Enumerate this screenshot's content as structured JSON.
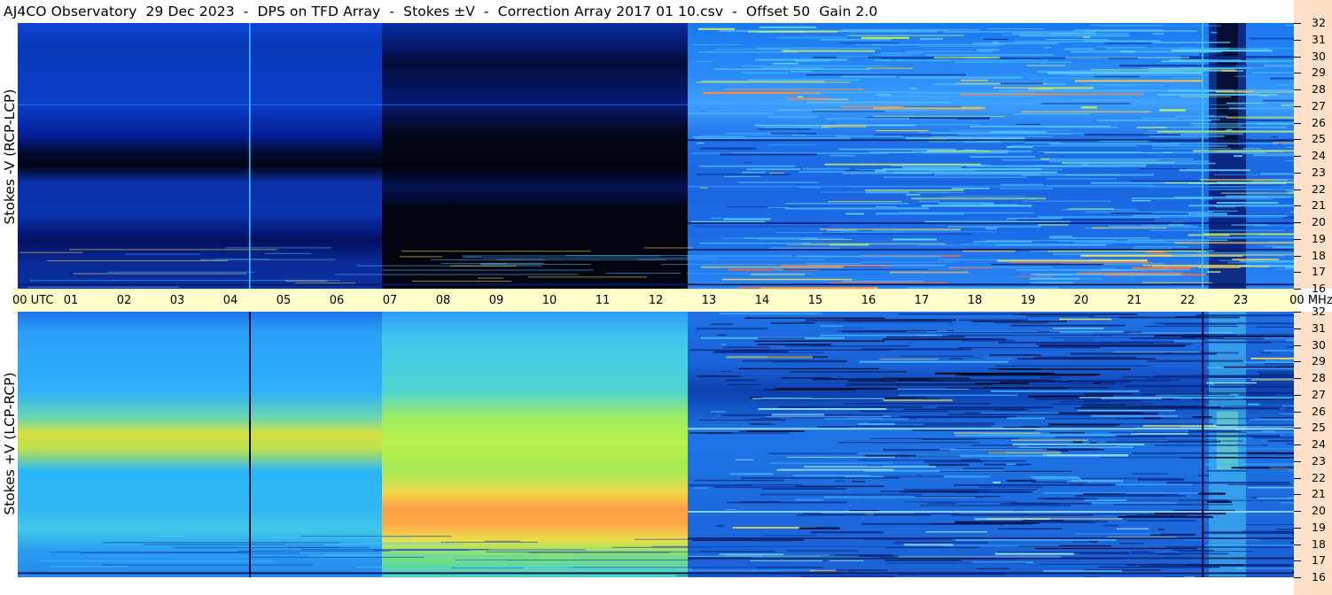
{
  "header": {
    "title": "AJ4CO Observatory  29 Dec 2023  -  DPS on TFD Array  -  Stokes ±V  -  Correction Array 2017 01 10.csv  -  Offset 50  Gain 2.0"
  },
  "chart_data": [
    {
      "type": "heatmap",
      "panel": "top",
      "title": "",
      "ylabel": "Stokes -V (RCP-LCP)",
      "xlabel": "",
      "x_unit": "UTC",
      "y_unit": "MHz",
      "xlim": [
        0,
        24
      ],
      "ylim": [
        16,
        32
      ],
      "y_ticks": [
        16,
        17,
        18,
        19,
        20,
        21,
        22,
        23,
        24,
        25,
        26,
        27,
        28,
        29,
        30,
        31,
        32
      ],
      "features": [
        {
          "x0": 0,
          "x1": 6.85,
          "y0": 16,
          "y1": 32,
          "level": "medium-dark blue"
        },
        {
          "x0": 6.85,
          "x1": 12.6,
          "y0": 16,
          "y1": 32,
          "level": "very dark blue/black"
        },
        {
          "x0": 12.6,
          "x1": 24,
          "y0": 16,
          "y1": 32,
          "level": "bright blue, noisy"
        },
        {
          "x0": 22.4,
          "x1": 23.1,
          "y0": 16,
          "y1": 32,
          "level": "dark band"
        }
      ],
      "colors": {
        "low": "#000033",
        "mid": "#0a3fd6",
        "high": "#3fa8ff",
        "hot": "#ffd84a"
      }
    },
    {
      "type": "heatmap",
      "panel": "bottom",
      "title": "",
      "ylabel": "Stokes +V (LCP-RCP)",
      "xlabel": "",
      "x_unit": "UTC",
      "y_unit": "MHz",
      "xlim": [
        0,
        24
      ],
      "ylim": [
        16,
        32
      ],
      "y_ticks": [
        16,
        17,
        18,
        19,
        20,
        21,
        22,
        23,
        24,
        25,
        26,
        27,
        28,
        29,
        30,
        31,
        32
      ],
      "features": [
        {
          "x0": 0,
          "x1": 6.85,
          "y0": 16,
          "y1": 32,
          "level": "cyan-blue"
        },
        {
          "x0": 6.85,
          "x1": 12.6,
          "y0": 16,
          "y1": 32,
          "level": "cyan/green, yellow-orange near 19-21 MHz"
        },
        {
          "x0": 12.6,
          "x1": 24,
          "y0": 16,
          "y1": 32,
          "level": "medium blue, noisy"
        },
        {
          "x0": 22.4,
          "x1": 23.1,
          "y0": 16,
          "y1": 32,
          "level": "light cyan band"
        }
      ],
      "colors": {
        "low": "#0a3fd6",
        "mid": "#2dc0ff",
        "high": "#a8f04a",
        "hot": "#ffa040"
      }
    }
  ],
  "time_axis": {
    "labels": [
      "00  UTC",
      "01",
      "02",
      "03",
      "04",
      "05",
      "06",
      "07",
      "08",
      "09",
      "10",
      "11",
      "12",
      "13",
      "14",
      "15",
      "16",
      "17",
      "18",
      "19",
      "20",
      "21",
      "22",
      "23",
      "00 MHz"
    ]
  }
}
